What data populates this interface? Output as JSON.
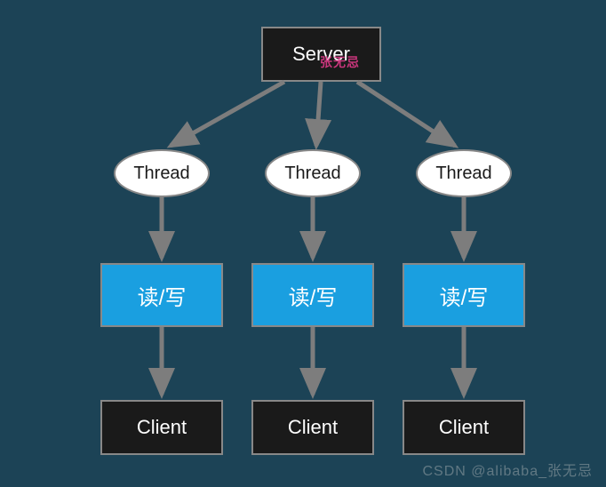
{
  "server": {
    "label": "Server"
  },
  "threads": [
    {
      "label": "Thread"
    },
    {
      "label": "Thread"
    },
    {
      "label": "Thread"
    }
  ],
  "rw": [
    {
      "label": "读/写"
    },
    {
      "label": "读/写"
    },
    {
      "label": "读/写"
    }
  ],
  "clients": [
    {
      "label": "Client"
    },
    {
      "label": "Client"
    },
    {
      "label": "Client"
    }
  ],
  "watermark_server": "张无忌",
  "watermark_csdn": "CSDN @alibaba_张无忌",
  "colors": {
    "background": "#1c4356",
    "node_dark": "#1a1a1a",
    "node_blue": "#1a9fe0",
    "node_white": "#ffffff",
    "arrow": "#7d7d7d"
  }
}
